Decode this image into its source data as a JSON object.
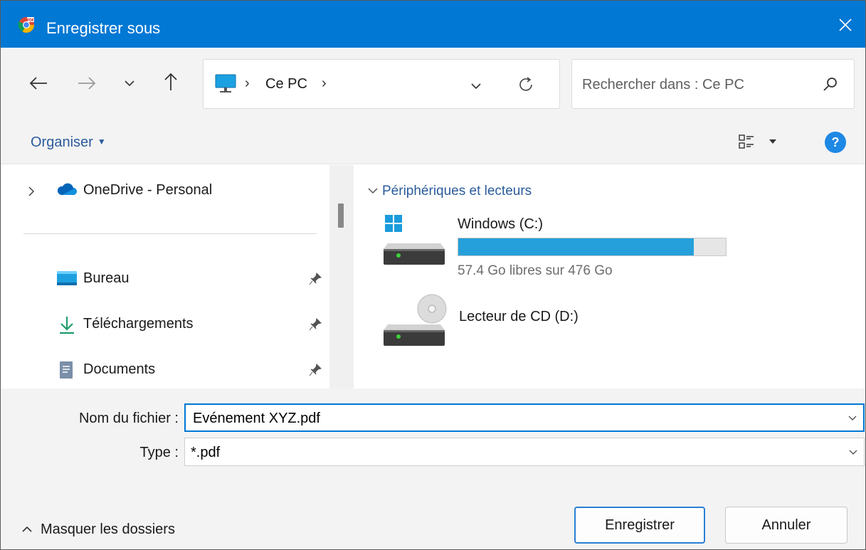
{
  "window": {
    "title": "Enregistrer sous",
    "accent_color": "#0078d4"
  },
  "address_bar": {
    "location_icon": "monitor-icon",
    "breadcrumb": [
      "Ce PC"
    ],
    "search_placeholder": "Rechercher dans : Ce PC"
  },
  "toolbar": {
    "organise_label": "Organiser"
  },
  "nav_pane": {
    "top_items": [
      {
        "label": "OneDrive - Personal",
        "icon": "cloud-icon"
      }
    ],
    "quick_access": [
      {
        "label": "Bureau",
        "icon": "desktop-folder-icon",
        "pinned": true
      },
      {
        "label": "Téléchargements",
        "icon": "download-icon",
        "pinned": true
      },
      {
        "label": "Documents",
        "icon": "document-icon",
        "pinned": true
      }
    ]
  },
  "content": {
    "group_label": "Périphériques et lecteurs",
    "drives": [
      {
        "name": "Windows (C:)",
        "free_text": "57.4 Go libres sur 476 Go",
        "used_fraction": 0.879,
        "bar_color": "#26a0da",
        "icon": "windows-drive-icon"
      },
      {
        "name": "Lecteur de CD (D:)",
        "icon": "cd-drive-icon"
      }
    ]
  },
  "bottom": {
    "filename_label": "Nom du fichier :",
    "filename_value": "Evénement XYZ.pdf",
    "type_label": "Type :",
    "type_value": "*.pdf",
    "hide_folders_label": "Masquer les dossiers",
    "save_label": "Enregistrer",
    "cancel_label": "Annuler"
  }
}
